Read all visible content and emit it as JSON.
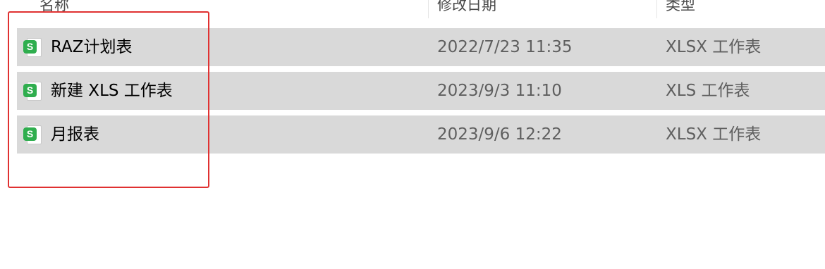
{
  "columns": {
    "name": "名称",
    "date_modified": "修改日期",
    "type": "类型"
  },
  "files": [
    {
      "name": "RAZ计划表",
      "date_modified": "2022/7/23 11:35",
      "type": "XLSX 工作表",
      "icon": "spreadsheet-file-icon",
      "icon_letter": "S"
    },
    {
      "name": "新建 XLS 工作表",
      "date_modified": "2023/9/3 11:10",
      "type": "XLS 工作表",
      "icon": "spreadsheet-file-icon",
      "icon_letter": "S"
    },
    {
      "name": "月报表",
      "date_modified": "2023/9/6 12:22",
      "type": "XLSX 工作表",
      "icon": "spreadsheet-file-icon",
      "icon_letter": "S"
    }
  ],
  "colors": {
    "row_selected_bg": "#d9d9d9",
    "icon_green": "#2fae4e",
    "annotation_red": "#e03131"
  }
}
